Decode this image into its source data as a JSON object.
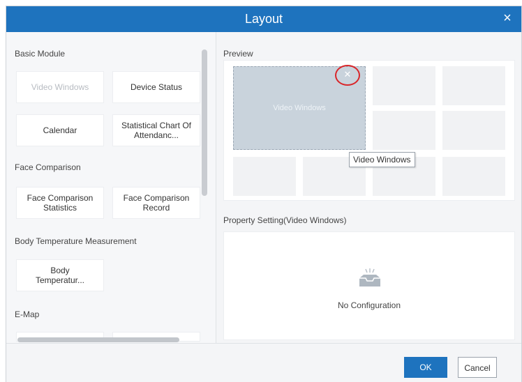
{
  "dialog": {
    "title": "Layout",
    "close_icon": "×"
  },
  "modules": {
    "sections": [
      {
        "title": "Basic Module",
        "items": [
          "Video Windows",
          "Device Status",
          "Calendar",
          "Statistical Chart Of Attendanc..."
        ]
      },
      {
        "title": "Face Comparison",
        "items": [
          "Face Comparison Statistics",
          "Face Comparison Record"
        ]
      },
      {
        "title": "Body Temperature Measurement",
        "items": [
          "Body Temperatur..."
        ]
      },
      {
        "title": "E-Map",
        "items": []
      }
    ]
  },
  "preview": {
    "label": "Preview",
    "selected_window": "Video Windows",
    "tooltip": "Video Windows"
  },
  "property": {
    "label": "Property Setting(Video Windows)",
    "empty_text": "No Configuration"
  },
  "footer": {
    "ok_label": "OK",
    "cancel_label": "Cancel"
  },
  "colors": {
    "titlebar": "#1e73be",
    "primary_button": "#1e73be",
    "highlight_circle": "#d9262a"
  }
}
